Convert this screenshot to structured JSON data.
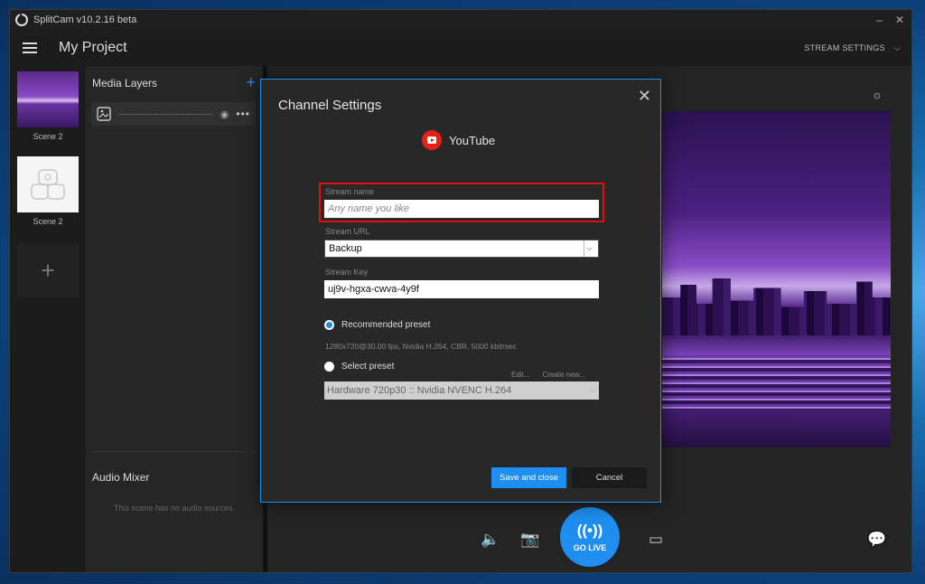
{
  "window": {
    "title": "SplitCam v10.2.16 beta",
    "minimize": "–",
    "close": "✕"
  },
  "header": {
    "project_title": "My Project",
    "stream_settings": "STREAM SETTINGS"
  },
  "scenes": [
    {
      "label": "Scene 2"
    },
    {
      "label": "Scene 2"
    }
  ],
  "add_scene": "+",
  "layers": {
    "title": "Media Layers",
    "add": "+"
  },
  "mixer": {
    "title": "Audio Mixer",
    "empty": "This scene has no audio sources."
  },
  "go_live": {
    "label": "GO LIVE"
  },
  "dialog": {
    "title": "Channel Settings",
    "platform": "YouTube",
    "stream_name": {
      "label": "Stream name",
      "placeholder": "Any name you like",
      "value": ""
    },
    "stream_url": {
      "label": "Stream URL",
      "value": "Backup"
    },
    "stream_key": {
      "label": "Stream Key",
      "value": "uj9v-hgxa-cwva-4y9f"
    },
    "recommended_preset": {
      "label": "Recommended preset",
      "selected": true,
      "description": "1280x720@30.00 fps, Nvidia H.264, CBR, 5000 kbit/sec"
    },
    "select_preset": {
      "label": "Select preset",
      "selected": false,
      "edit": "Edit...",
      "create": "Create new...",
      "value": "Hardware 720p30 :: Nvidia NVENC H.264"
    },
    "save_button": "Save and close",
    "cancel_button": "Cancel",
    "close": "✕"
  },
  "colors": {
    "accent": "#1e8ef0",
    "highlight": "#e01010",
    "youtube": "#e62117"
  }
}
